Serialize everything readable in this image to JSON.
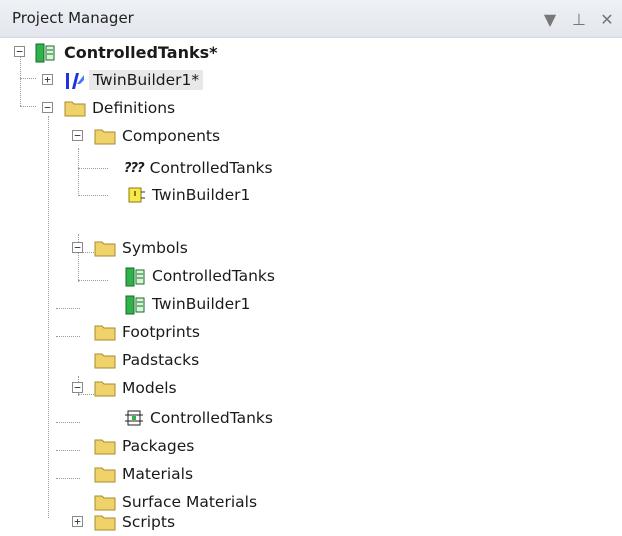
{
  "panel": {
    "title": "Project Manager",
    "buttons": {
      "dropdown": "▼",
      "pin": "⊥",
      "close": "✕"
    }
  },
  "tree": {
    "root": "ControlledTanks*",
    "twinbuilder": "TwinBuilder1*",
    "definitions": "Definitions",
    "components": "Components",
    "components_items": [
      "ControlledTanks",
      "TwinBuilder1"
    ],
    "unknown_prefix": "???",
    "symbols": "Symbols",
    "symbols_items": [
      "ControlledTanks",
      "TwinBuilder1"
    ],
    "footprints": "Footprints",
    "padstacks": "Padstacks",
    "models": "Models",
    "models_items": [
      "ControlledTanks"
    ],
    "packages": "Packages",
    "materials": "Materials",
    "surface_materials": "Surface Materials",
    "scripts": "Scripts"
  },
  "expander": {
    "expanded": "−",
    "collapsed": "+"
  },
  "colors": {
    "folder": "#f0d26a",
    "folder_edge": "#a98b2b",
    "green_icon": "#2fb24a",
    "blue_icon": "#2233dd"
  }
}
